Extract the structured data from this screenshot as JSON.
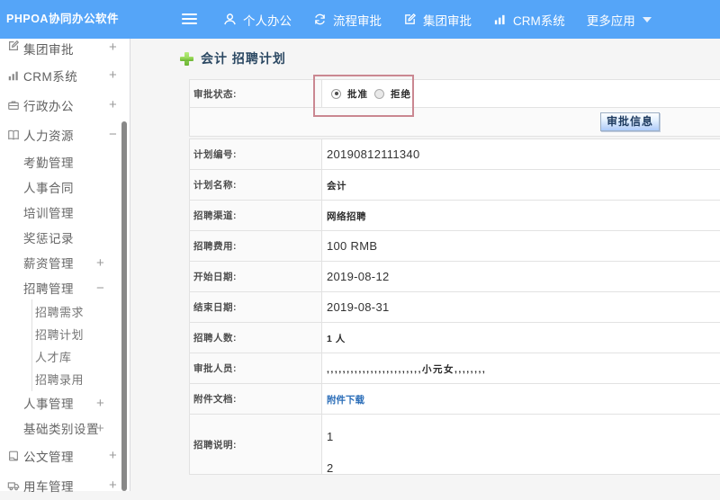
{
  "topbar": {
    "brand": "PHPOA协同办公软件",
    "nav": [
      {
        "label": "个人办公",
        "icon": "user-icon"
      },
      {
        "label": "流程审批",
        "icon": "process-icon"
      },
      {
        "label": "集团审批",
        "icon": "edit-icon"
      },
      {
        "label": "CRM系统",
        "icon": "chart-icon"
      },
      {
        "label": "更多应用",
        "icon": ""
      }
    ]
  },
  "sidebar": {
    "items": [
      {
        "label": "集团审批",
        "level": 1,
        "icon": "edit-icon",
        "toggle": "+"
      },
      {
        "label": "CRM系统",
        "level": 1,
        "icon": "chart-icon",
        "toggle": "+"
      },
      {
        "label": "行政办公",
        "level": 1,
        "icon": "briefcase-icon",
        "toggle": "+"
      },
      {
        "label": "人力资源",
        "level": 1,
        "icon": "book-icon",
        "toggle": "−"
      },
      {
        "label": "考勤管理",
        "level": 2,
        "icon": "",
        "toggle": ""
      },
      {
        "label": "人事合同",
        "level": 2,
        "icon": "",
        "toggle": ""
      },
      {
        "label": "培训管理",
        "level": 2,
        "icon": "",
        "toggle": ""
      },
      {
        "label": "奖惩记录",
        "level": 2,
        "icon": "",
        "toggle": ""
      },
      {
        "label": "薪资管理",
        "level": 2,
        "icon": "",
        "toggle": "+"
      },
      {
        "label": "招聘管理",
        "level": 2,
        "icon": "",
        "toggle": "−"
      },
      {
        "label": "招聘需求",
        "level": 3,
        "icon": "",
        "toggle": ""
      },
      {
        "label": "招聘计划",
        "level": 3,
        "icon": "",
        "toggle": ""
      },
      {
        "label": "人才库",
        "level": 3,
        "icon": "",
        "toggle": ""
      },
      {
        "label": "招聘录用",
        "level": 3,
        "icon": "",
        "toggle": ""
      },
      {
        "label": "人事管理",
        "level": 2,
        "icon": "",
        "toggle": "+"
      },
      {
        "label": "基础类别设置",
        "level": 2,
        "icon": "",
        "toggle": "+"
      },
      {
        "label": "公文管理",
        "level": 1,
        "icon": "doc-icon",
        "toggle": "+"
      },
      {
        "label": "用车管理",
        "level": 1,
        "icon": "truck-icon",
        "toggle": "+"
      }
    ]
  },
  "content": {
    "title": "会计 招聘计划",
    "approval": {
      "label": "审批状态:",
      "options": [
        {
          "label": "批准",
          "selected": true
        },
        {
          "label": "拒绝",
          "selected": false
        }
      ],
      "button_label": "审批信息"
    },
    "fields": [
      {
        "label": "计划编号:",
        "value": "20190812111340",
        "style": "num"
      },
      {
        "label": "计划名称:",
        "value": "会计",
        "style": "cjk"
      },
      {
        "label": "招聘渠道:",
        "value": "网络招聘",
        "style": "cjk"
      },
      {
        "label": "招聘费用:",
        "value": "100 RMB",
        "style": "num"
      },
      {
        "label": "开始日期:",
        "value": "2019-08-12",
        "style": "num"
      },
      {
        "label": "结束日期:",
        "value": "2019-08-31",
        "style": "num"
      },
      {
        "label": "招聘人数:",
        "value": "1 人",
        "style": "cjk"
      },
      {
        "label": "审批人员:",
        "value": ",,,,,,,,,,,,,,,,,,,,,,,,小元女,,,,,,,,",
        "style": "cjk"
      },
      {
        "label": "附件文档:",
        "value": "附件下载",
        "style": "link"
      },
      {
        "label": "招聘说明:",
        "value": "1\n2",
        "style": "multi"
      }
    ]
  },
  "colors": {
    "topbar_bg": "#55a5f8",
    "content_bg": "#f5f5f5",
    "table_border": "#e2e2e2",
    "annotation_red": "#c16873",
    "link_blue": "#2a6db8",
    "title_blue": "#2c4963"
  }
}
